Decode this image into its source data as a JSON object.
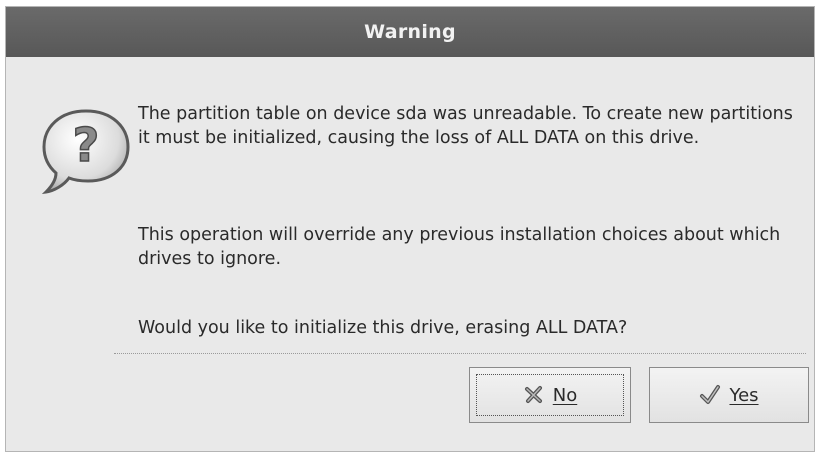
{
  "dialog": {
    "title": "Warning",
    "icon": "question-bubble-icon",
    "message": {
      "p1": "The partition table on device sda was unreadable. To create new partitions it must be initialized, causing the loss of ALL DATA on this drive.",
      "p2": "This operation will override any previous installation choices about which drives to ignore.",
      "p3": "Would you like to initialize this drive, erasing ALL DATA?"
    },
    "buttons": {
      "no_label": "No",
      "no_icon": "x-cross-icon",
      "yes_label": "Yes",
      "yes_icon": "checkmark-icon"
    }
  },
  "colors": {
    "titlebar": "#5f5f5f",
    "dialog_bg": "#e9e9e9",
    "text": "#2a2a2a"
  }
}
